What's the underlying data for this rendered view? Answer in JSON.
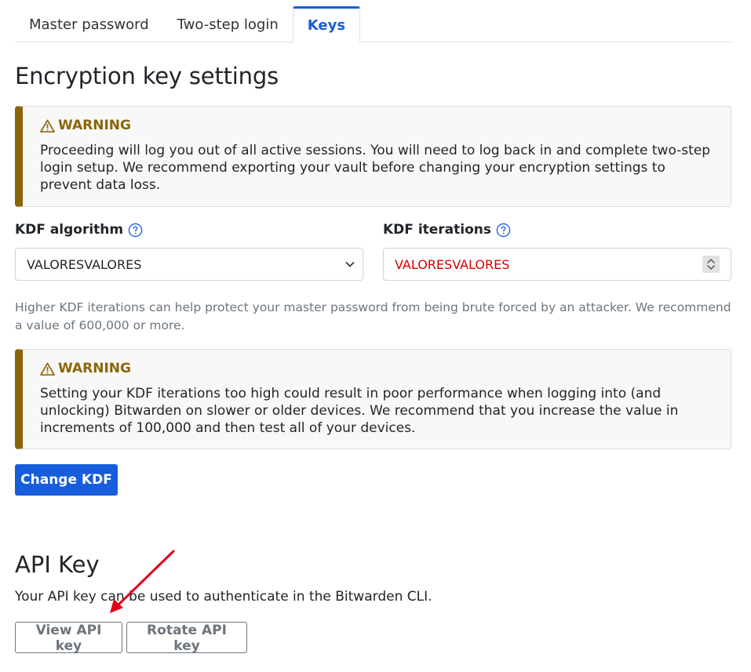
{
  "tabs": [
    {
      "label": "Master password",
      "active": false
    },
    {
      "label": "Two-step login",
      "active": false
    },
    {
      "label": "Keys",
      "active": true
    }
  ],
  "encryption": {
    "title": "Encryption key settings",
    "warning1": {
      "heading": "WARNING",
      "body": "Proceeding will log you out of all active sessions. You will need to log back in and complete two-step login setup. We recommend exporting your vault before changing your encryption settings to prevent data loss."
    },
    "kdf_algorithm_label": "KDF algorithm",
    "kdf_algorithm_value": "VALORESVALORES",
    "kdf_iterations_label": "KDF iterations",
    "kdf_iterations_value": "VALORESVALORES",
    "help_text": "Higher KDF iterations can help protect your master password from being brute forced by an attacker. We recommend a value of 600,000 or more.",
    "warning2": {
      "heading": "WARNING",
      "body": "Setting your KDF iterations too high could result in poor performance when logging into (and unlocking) Bitwarden on slower or older devices. We recommend that you increase the value in increments of 100,000 and then test all of your devices."
    },
    "change_kdf_label": "Change KDF"
  },
  "api": {
    "title": "API Key",
    "description": "Your API key can be used to authenticate in the Bitwarden CLI.",
    "view_label": "View API key",
    "rotate_label": "Rotate API key"
  },
  "colors": {
    "accent": "#175ddc",
    "warning": "#8b6609",
    "annotation_arrow": "#e3001b",
    "error_text": "#d40000"
  },
  "icons": {
    "warning": "warning-triangle-icon",
    "help": "question-circle-icon",
    "select": "chevron-down-icon",
    "spinner": "number-spinner-icon"
  }
}
